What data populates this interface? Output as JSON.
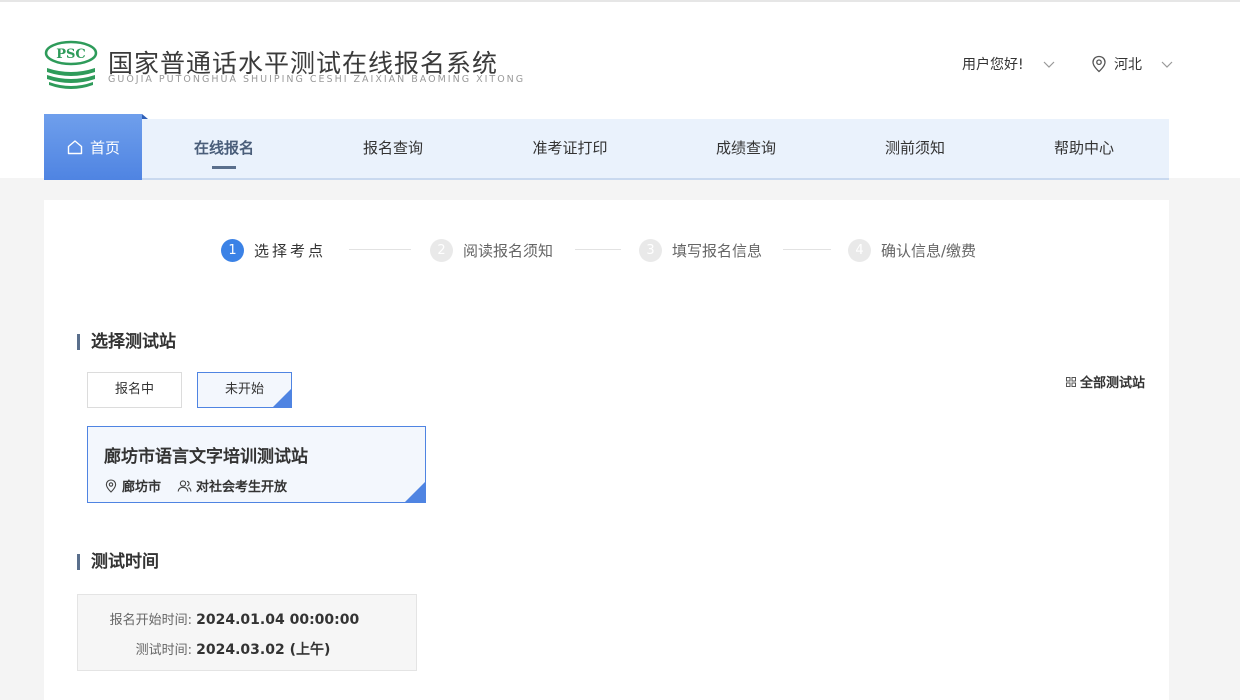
{
  "header": {
    "logo_badge": "PSC",
    "title": "国家普通话水平测试在线报名系统",
    "subtitle": "GUOJIA PUTONGHUA SHUIPING CESHI ZAIXIAN BAOMING XITONG",
    "user_greeting": "用户您好!",
    "region": "河北"
  },
  "nav": {
    "home": "首页",
    "items": [
      "在线报名",
      "报名查询",
      "准考证打印",
      "成绩查询",
      "测前须知",
      "帮助中心"
    ],
    "active_index": 0
  },
  "steps": [
    {
      "num": "1",
      "label": "选择考点",
      "active": true
    },
    {
      "num": "2",
      "label": "阅读报名须知",
      "active": false
    },
    {
      "num": "3",
      "label": "填写报名信息",
      "active": false
    },
    {
      "num": "4",
      "label": "确认信息/缴费",
      "active": false
    }
  ],
  "station_section": {
    "title": "选择测试站",
    "filters": [
      "报名中",
      "未开始"
    ],
    "selected_filter": "未开始",
    "all_stations_label": "全部测试站",
    "station": {
      "name": "廊坊市语言文字培训测试站",
      "city": "廊坊市",
      "audience": "对社会考生开放"
    }
  },
  "time_section": {
    "title": "测试时间",
    "rows": [
      {
        "label": "报名开始时间:",
        "value": "2024.01.04 00:00:00"
      },
      {
        "label": "测试时间:",
        "value": "2024.03.02 (上午)"
      }
    ]
  },
  "colors": {
    "accent": "#4f84e2",
    "nav_bg": "#eaf2fc",
    "logo_green": "#2e9b5a",
    "section_bar": "#5a6f8c"
  }
}
